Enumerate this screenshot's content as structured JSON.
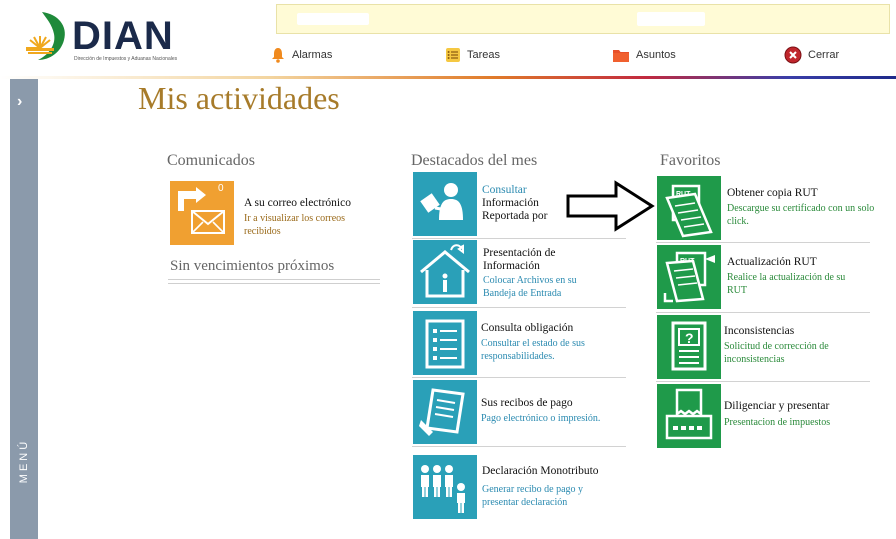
{
  "logo": {
    "name": "DIAN",
    "subtitle": "Dirección de Impuestos y Aduanas Nacionales"
  },
  "nav": [
    {
      "label": "Alarmas",
      "icon": "bell-icon"
    },
    {
      "label": "Tareas",
      "icon": "task-list-icon"
    },
    {
      "label": "Asuntos",
      "icon": "folder-icon"
    },
    {
      "label": "Cerrar",
      "icon": "close-circle-icon"
    }
  ],
  "sidebar": {
    "menu_label": "MENÚ",
    "toggle_icon": "chevron-right-icon"
  },
  "page": {
    "title": "Mis actividades"
  },
  "comunicados": {
    "title": "Comunicados",
    "item": {
      "count": "0",
      "title": "A su correo electrónico",
      "link": "Ir a visualizar los correos recibidos",
      "icon": "email-icon",
      "color": "#f0a031"
    },
    "no_due": "Sin vencimientos próximos"
  },
  "destacados": {
    "title": "Destacados del mes",
    "items": [
      {
        "title": "Consultar",
        "title2": "Información Reportada por terceros",
        "link": "",
        "icon": "person-document-icon"
      },
      {
        "title": "Presentación de Información",
        "link": "Colocar Archivos en su Bandeja de Entrada",
        "icon": "house-info-icon"
      },
      {
        "title": "Consulta obligación",
        "link": "Consultar el estado de sus responsabilidades.",
        "icon": "form-list-icon"
      },
      {
        "title": "Sus recibos de pago",
        "link": "Pago electrónico o impresión.",
        "icon": "receipt-pen-icon"
      },
      {
        "title": "Declaración Monotributo",
        "link": "Generar recibo de pago y presentar declaración",
        "icon": "people-group-icon"
      }
    ],
    "color": "#2aa0b8"
  },
  "favoritos": {
    "title": "Favoritos",
    "items": [
      {
        "title": "Obtener copia RUT",
        "link": "Descargue su certificado con un solo click.",
        "icon": "rut-copy-icon"
      },
      {
        "title": "Actualización RUT",
        "link": "Realice la actualización de su RUT",
        "icon": "rut-update-icon"
      },
      {
        "title": "Inconsistencias",
        "link": "Solicitud de corrección de inconsistencias",
        "icon": "question-document-icon"
      },
      {
        "title": "Diligenciar y presentar",
        "link": "Presentacion de impuestos",
        "icon": "tax-terminal-icon"
      }
    ],
    "color": "#1f9a4a"
  }
}
